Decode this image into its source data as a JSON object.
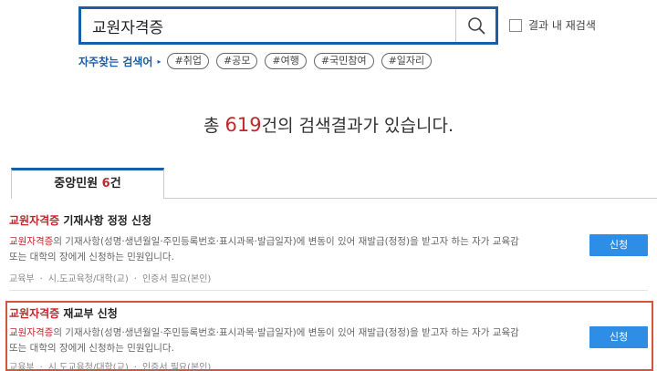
{
  "search": {
    "value": "교원자격증"
  },
  "research_label": "결과 내 재검색",
  "popular": {
    "title": "자주찾는 검색어",
    "arrow": "▸",
    "tags": [
      "#취업",
      "#공모",
      "#여행",
      "#국민참여",
      "#일자리"
    ]
  },
  "summary": {
    "prefix": "총 ",
    "count": "619",
    "suffix": "건의 검색결과가 있습니다."
  },
  "tab": {
    "label": "중앙민원 ",
    "count": "6",
    "unit": "건"
  },
  "results": [
    {
      "title_kw": "교원자격증",
      "title_rest": " 기재사항 정정 신청",
      "desc_kw": "교원자격증",
      "desc_rest": "의 기재사항(성명·생년월일·주민등록번호·표시과목·발급일자)에 변동이 있어 재발급(정정)을 받고자 하는 자가 교육감 또는 대학의 장에게 신청하는 민원입니다.",
      "meta": [
        "교육부",
        "시.도교육청/대학(교)",
        "인증서 필요(본인)"
      ],
      "button": "신청"
    },
    {
      "title_kw": "교원자격증",
      "title_rest": " 재교부 신청",
      "desc_kw": "교원자격증",
      "desc_rest": "의 기재사항(성명·생년월일·주민등록번호·표시과목·발급일자)에 변동이 있어 재발급(정정)을 받고자 하는 자가 교육감 또는 대학의 장에게 신청하는 민원입니다.",
      "meta": [
        "교육부",
        "시.도교육청/대학(교)",
        "인증서 필요(본인)"
      ],
      "button": "신청"
    }
  ],
  "colors": {
    "brand_blue": "#1a5ea8",
    "keyword_red": "#c0272d",
    "button_blue": "#2e8ee5",
    "highlight_border": "#d2553f"
  }
}
